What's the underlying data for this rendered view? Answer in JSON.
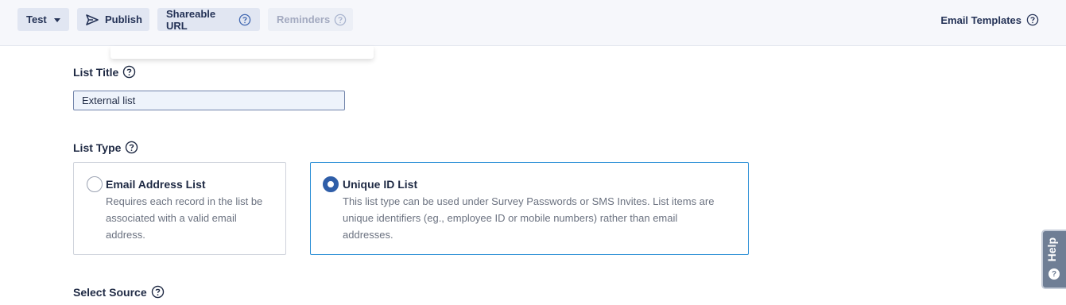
{
  "toolbar": {
    "test_label": "Test",
    "publish_label": "Publish",
    "shareable_label": "Shareable URL",
    "reminders_label": "Reminders"
  },
  "header": {
    "email_templates_label": "Email Templates"
  },
  "form": {
    "list_title_label": "List Title",
    "list_title_value": "External list",
    "list_type_label": "List Type",
    "select_source_label": "Select Source"
  },
  "list_types": [
    {
      "title": "Email Address List",
      "desc_lines": [
        "Requires each record in the list be",
        "associated with a valid email",
        "address."
      ],
      "selected": false
    },
    {
      "title": "Unique ID List",
      "desc_lines": [
        "This list type can be used under Survey Passwords or SMS Invites. List items are",
        "unique identifiers (eg., employee ID or mobile numbers) rather than email",
        "addresses."
      ],
      "selected": true
    }
  ],
  "help_tab": {
    "label": "Help",
    "dot": "?"
  },
  "colors": {
    "accent": "#2f5ea8",
    "selected_border": "#2b8fd6",
    "toolbar_bg": "#f6f7fb"
  }
}
